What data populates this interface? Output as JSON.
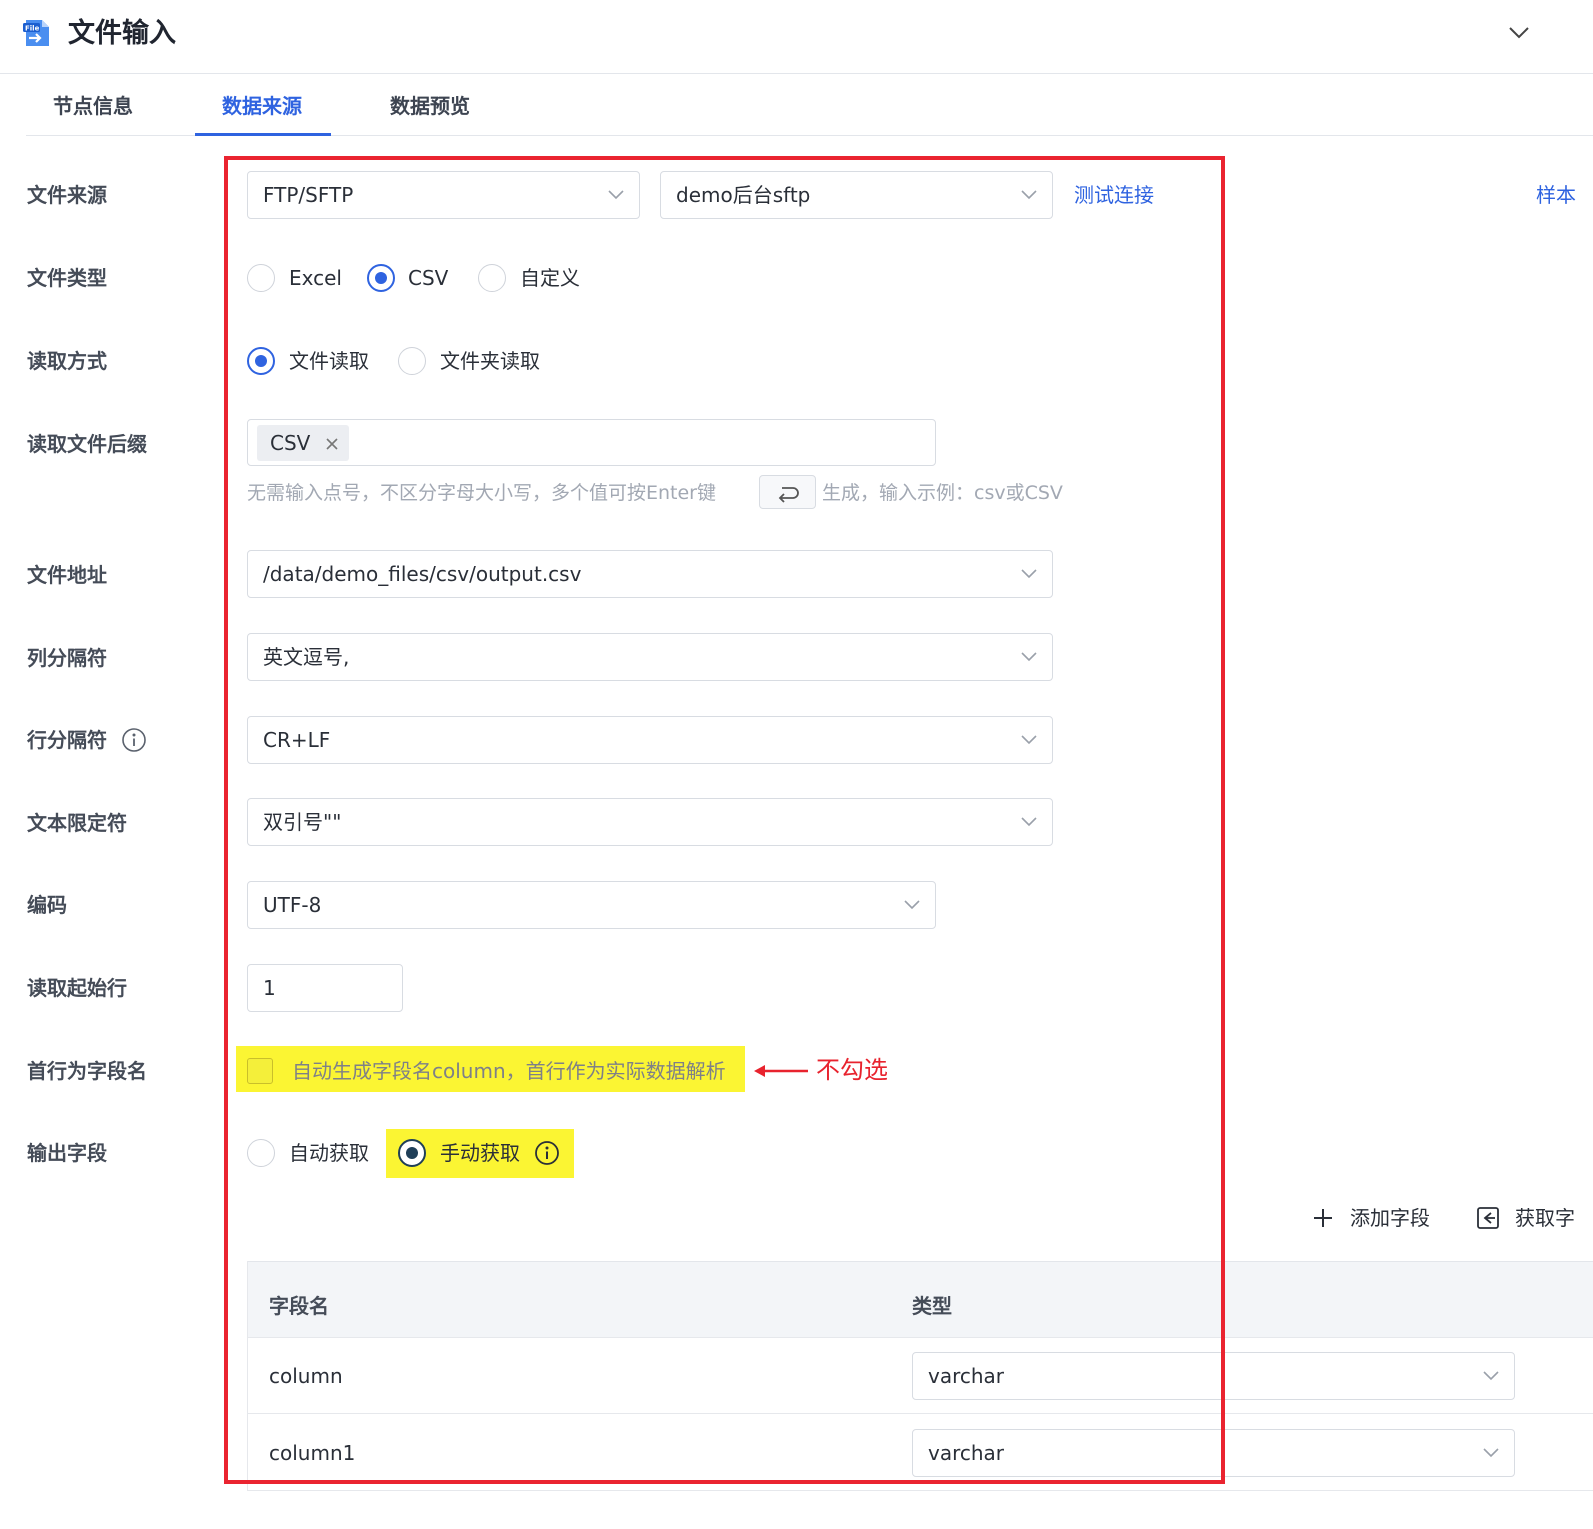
{
  "header": {
    "title": "文件输入",
    "icon_text": "File"
  },
  "tabs": [
    {
      "label": "节点信息"
    },
    {
      "label": "数据来源"
    },
    {
      "label": "数据预览"
    }
  ],
  "form": {
    "file_source": {
      "label": "文件来源",
      "protocol": "FTP/SFTP",
      "server": "demo后台sftp",
      "test_link": "测试连接",
      "sample_link": "样本"
    },
    "file_type": {
      "label": "文件类型",
      "options": [
        "Excel",
        "CSV",
        "自定义"
      ],
      "selected": "CSV"
    },
    "read_mode": {
      "label": "读取方式",
      "options": [
        "文件读取",
        "文件夹读取"
      ],
      "selected": "文件读取"
    },
    "suffix": {
      "label": "读取文件后缀",
      "tags": [
        "CSV"
      ],
      "hint_before": "无需输入点号，不区分字母大小写，多个值可按Enter键",
      "hint_after": "生成，输入示例：csv或CSV"
    },
    "file_path": {
      "label": "文件地址",
      "value": "/data/demo_files/csv/output.csv"
    },
    "col_sep": {
      "label": "列分隔符",
      "value": "英文逗号,"
    },
    "row_sep": {
      "label": "行分隔符",
      "value": "CR+LF"
    },
    "text_qualifier": {
      "label": "文本限定符",
      "value": "双引号\"\""
    },
    "encoding": {
      "label": "编码",
      "value": "UTF-8"
    },
    "start_row": {
      "label": "读取起始行",
      "value": "1"
    },
    "header_row": {
      "label": "首行为字段名",
      "checkbox_label": "自动生成字段名column，首行作为实际数据解析",
      "checked": false,
      "annotation": "不勾选"
    },
    "output_fields": {
      "label": "输出字段",
      "options": [
        "自动获取",
        "手动获取"
      ],
      "selected": "手动获取"
    }
  },
  "actions": {
    "add_field": "添加字段",
    "fetch_field": "获取字"
  },
  "table": {
    "headers": [
      "字段名",
      "类型"
    ],
    "rows": [
      {
        "name": "column",
        "type": "varchar"
      },
      {
        "name": "column1",
        "type": "varchar"
      }
    ]
  },
  "colors": {
    "accent": "#2f63e0",
    "highlight": "#fbf533",
    "annotation": "#e8232e"
  }
}
